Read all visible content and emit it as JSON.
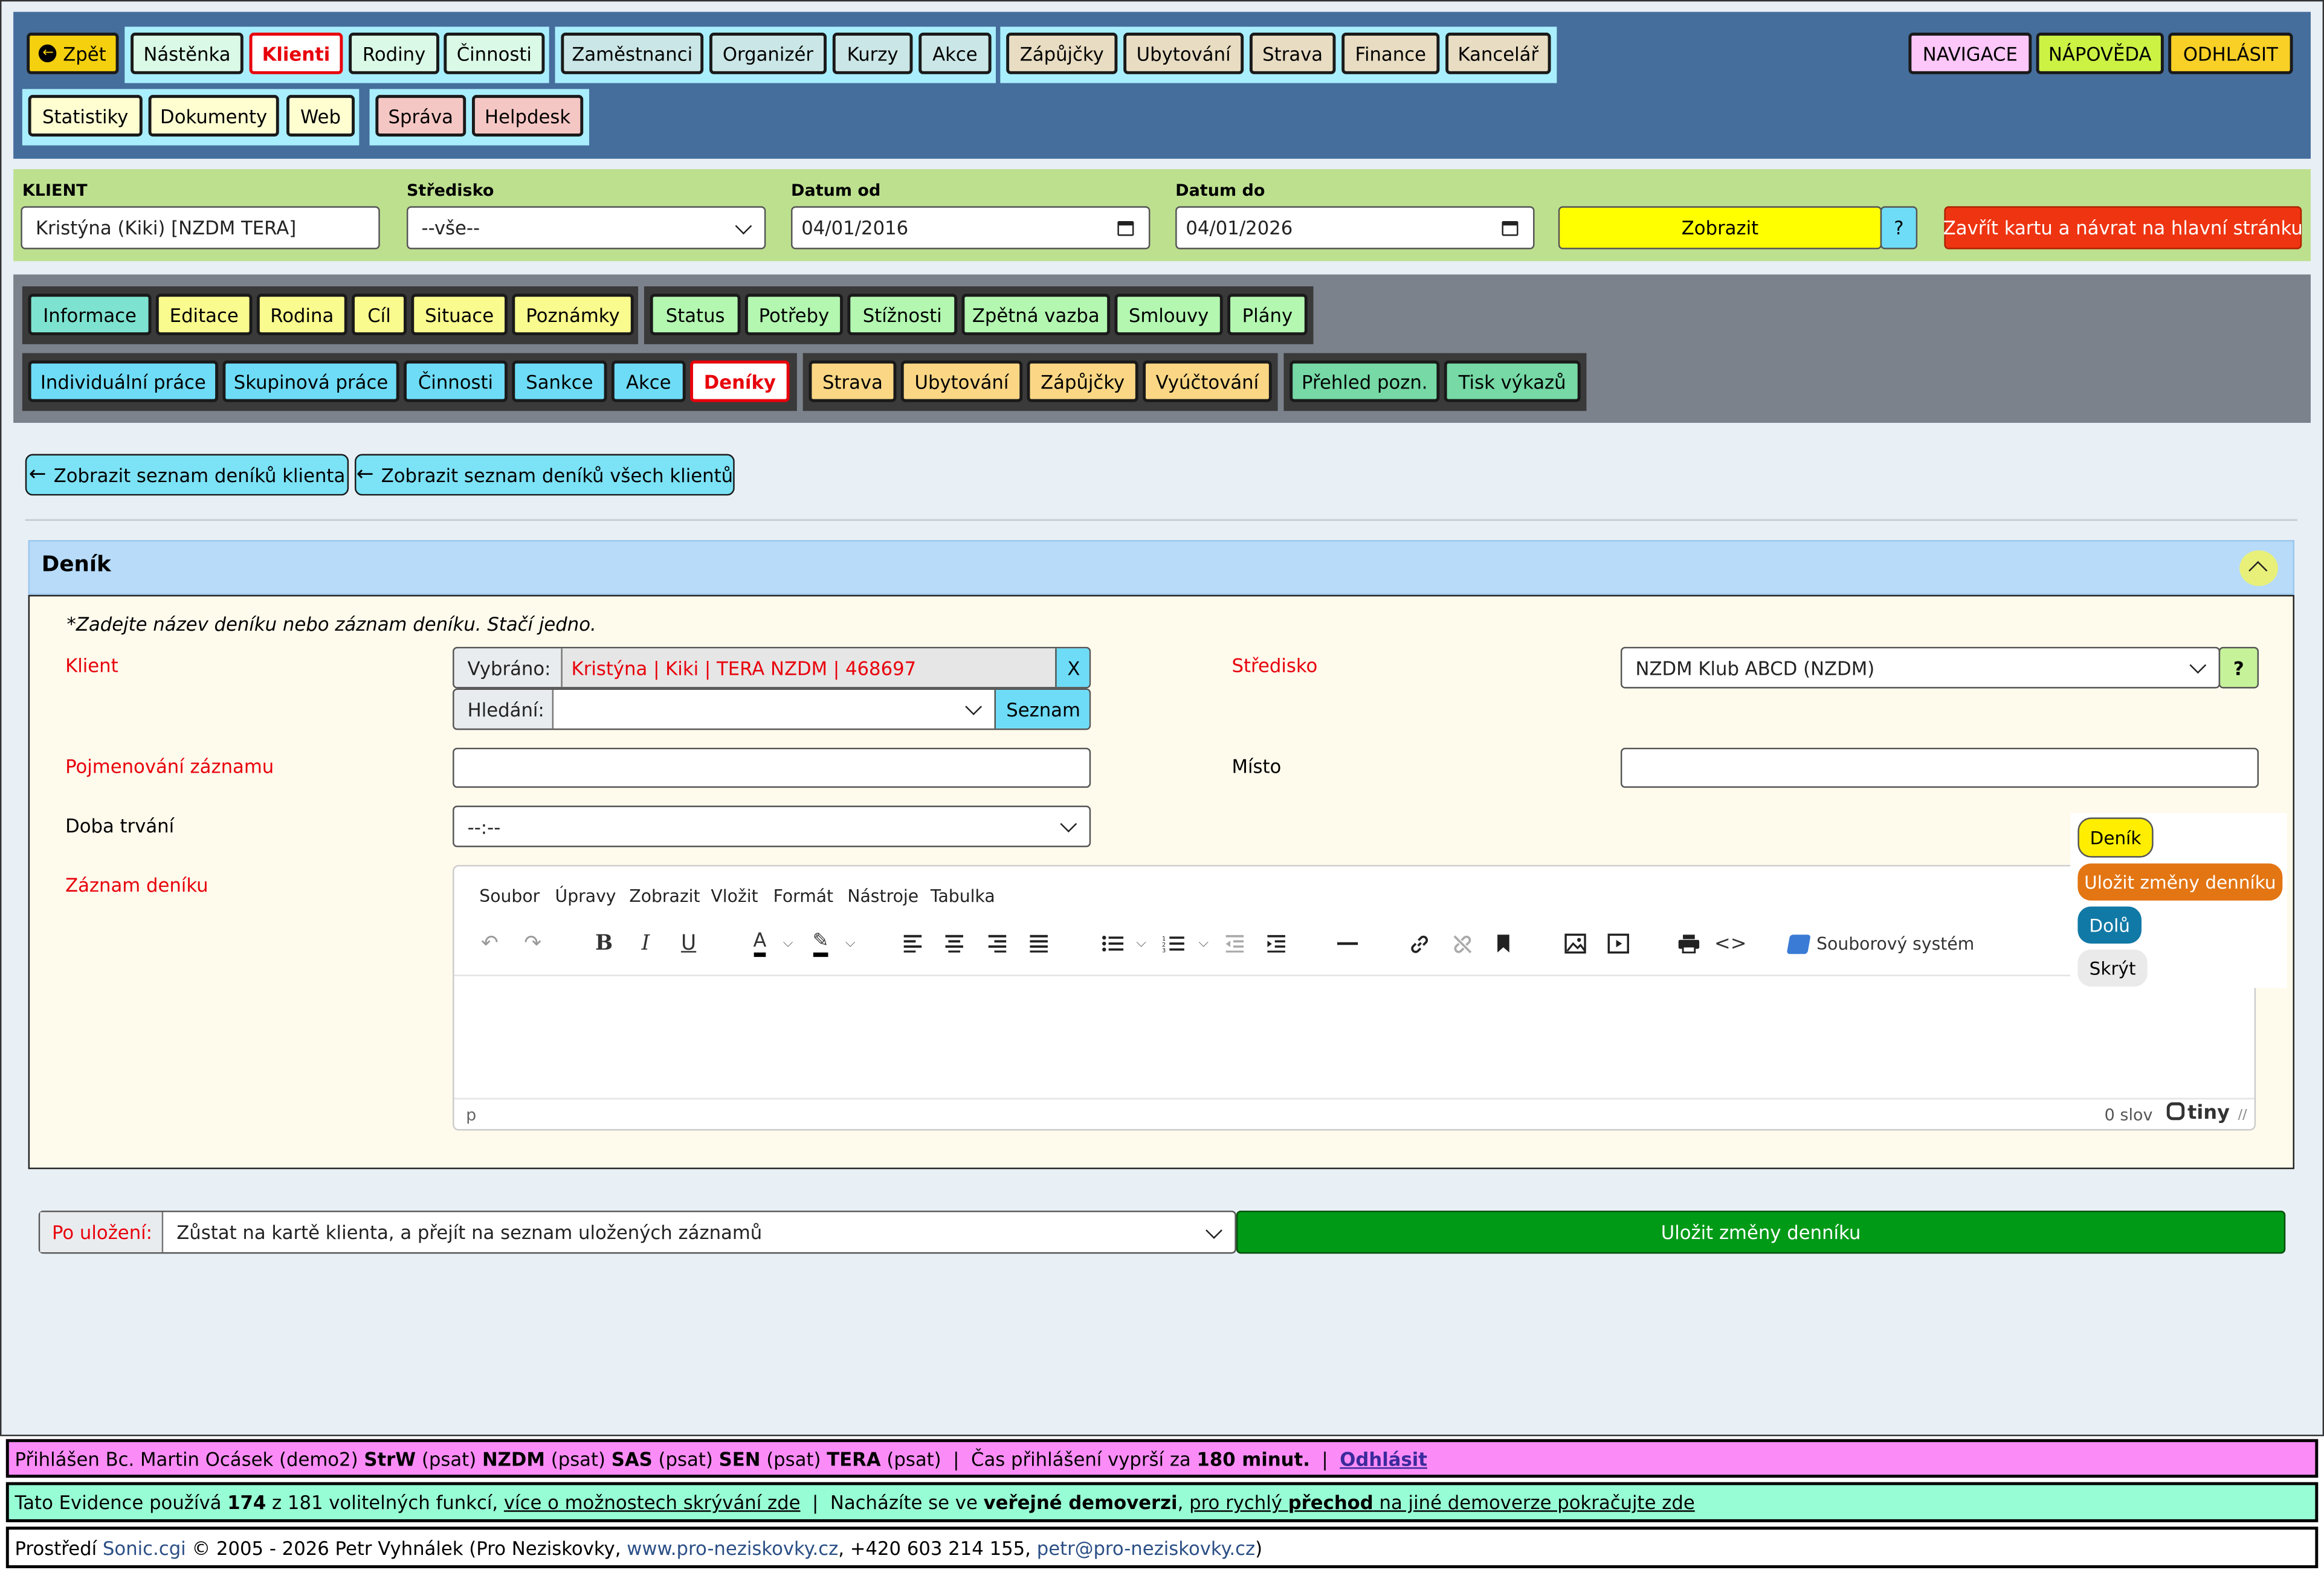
{
  "topnav": {
    "back": "Zpět",
    "group1": [
      "Nástěnka",
      "Klienti",
      "Rodiny",
      "Činnosti"
    ],
    "group2": [
      "Zaměstnanci",
      "Organizér",
      "Kurzy",
      "Akce"
    ],
    "group3": [
      "Zápůjčky",
      "Ubytování",
      "Strava",
      "Finance",
      "Kancelář"
    ],
    "group4": [
      "Statistiky",
      "Dokumenty",
      "Web"
    ],
    "group5": [
      "Správa",
      "Helpdesk"
    ],
    "right": [
      "NAVIGACE",
      "NÁPOVĚDA",
      "ODHLÁSIT"
    ]
  },
  "filter": {
    "client_label": "KLIENT",
    "client_value": "Kristýna (Kiki) [NZDM TERA]",
    "center_label": "Středisko",
    "center_value": "--vše--",
    "date_from_label": "Datum od",
    "date_from": "04/01/2016",
    "date_to_label": "Datum do",
    "date_to": "04/01/2026",
    "show": "Zobrazit",
    "help": "?",
    "close": "Zavřít kartu a návrat na hlavní stránku"
  },
  "tabs": {
    "row1a": [
      "Informace",
      "Editace",
      "Rodina",
      "Cíl",
      "Situace",
      "Poznámky"
    ],
    "row1b": [
      "Status",
      "Potřeby",
      "Stížnosti",
      "Zpětná vazba",
      "Smlouvy",
      "Plány"
    ],
    "row2a": [
      "Individuální práce",
      "Skupinová práce",
      "Činnosti",
      "Sankce",
      "Akce",
      "Deníky"
    ],
    "row2b": [
      "Strava",
      "Ubytování",
      "Zápůjčky",
      "Vyúčtování"
    ],
    "row2c": [
      "Přehled pozn.",
      "Tisk výkazů"
    ]
  },
  "actions": {
    "list_client": "Zobrazit seznam deníků klienta",
    "list_all": "Zobrazit seznam deníků všech klientů"
  },
  "panel": {
    "title": "Deník",
    "hint": "*Zadejte název deníku nebo záznam deníku. Stačí jedno.",
    "client_label": "Klient",
    "selected_label": "Vybráno:",
    "selected_value": "Kristýna | Kiki | TERA NZDM | 468697",
    "clear": "X",
    "search_label": "Hledání:",
    "list_btn": "Seznam",
    "center_label": "Středisko",
    "center_value": "NZDM Klub ABCD (NZDM)",
    "center_help": "?",
    "name_label": "Pojmenování záznamu",
    "place_label": "Místo",
    "duration_label": "Doba trvání",
    "duration_value": "--:--",
    "record_label": "Záznam deníku"
  },
  "editor": {
    "menus": [
      "Soubor",
      "Úpravy",
      "Zobrazit",
      "Vložit",
      "Formát",
      "Nástroje",
      "Tabulka"
    ],
    "filesystem": "Souborový systém",
    "path": "p",
    "words": "0 slov",
    "brand": "tiny"
  },
  "floating": {
    "denik": "Deník",
    "save": "Uložit změny denníku",
    "down": "Dolů",
    "hide": "Skrýt"
  },
  "savebar": {
    "after_label": "Po uložení:",
    "after_value": "Zůstat na kartě klienta, a přejít na seznam uložených záznamů",
    "save": "Uložit změny denníku"
  },
  "footer": {
    "l1_a": "Přihlášen Bc. Martin Ocásek (demo2) ",
    "l1_b1": "StrW",
    "l1_c1": " (psat) ",
    "l1_b2": "NZDM",
    "l1_c2": " (psat) ",
    "l1_b3": "SAS",
    "l1_c3": " (psat) ",
    "l1_b4": "SEN",
    "l1_c4": " (psat) ",
    "l1_b5": "TERA",
    "l1_c5": " (psat)  |  Čas přihlášení vyprší za ",
    "l1_b6": "180 minut.",
    "l1_sep": "  |  ",
    "l1_logout": "Odhlásit",
    "l2_a": "Tato Evidence používá ",
    "l2_b": "174",
    "l2_c": " z 181 volitelných funkcí, ",
    "l2_link": "více o možnostech skrývání zde",
    "l2_d": "  |  Nacházíte se ve ",
    "l2_e": "veřejné demoverzi",
    "l2_f": ", ",
    "l2_link2a": "pro rychlý ",
    "l2_link2b": "přechod",
    "l2_link2c": " na jiné demoverze pokračujte zde",
    "l3_a": "Prostředí ",
    "l3_sonic": "Sonic.cgi",
    "l3_b": " © 2005 - 2026 Petr Vyhnálek (Pro Neziskovky, ",
    "l3_web": "www.pro-neziskovky.cz",
    "l3_c": ", +420 603 214 155, ",
    "l3_mail": "petr@pro-neziskovky.cz",
    "l3_d": ")"
  },
  "colors": {
    "header": "#456e9c",
    "filter": "#bde08f",
    "tabsbar": "#7c828c",
    "panel_header": "#b7dbf9",
    "panel_bg": "#fefaec",
    "save_green": "#009a17",
    "close_red": "#ee3411"
  }
}
